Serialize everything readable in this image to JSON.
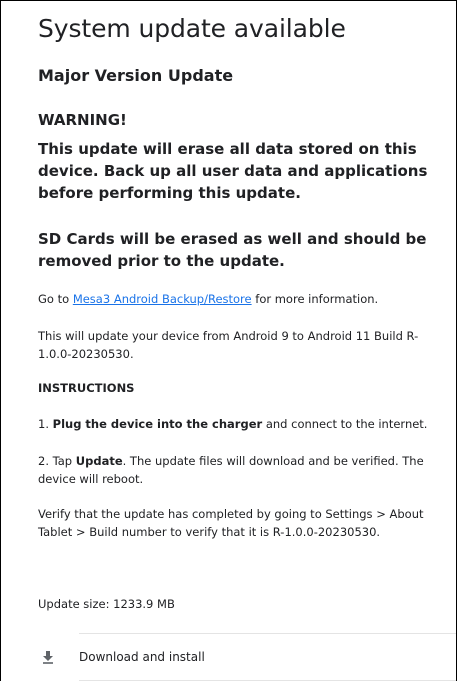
{
  "header": {
    "title": "System update available",
    "subtitle": "Major Version Update"
  },
  "warning": {
    "label": "WARNING!",
    "text": "This update will erase all data stored on this device. Back up all user data and applications before performing this update.",
    "sd_text": "SD Cards will be erased as well and should be removed prior to the update."
  },
  "info": {
    "go_to_prefix": "Go to ",
    "link_text": "Mesa3 Android Backup/Restore",
    "go_to_suffix": " for more information.",
    "android_update": "This will update your device from Android 9 to Android 11 Build R-1.0.0-20230530."
  },
  "instructions": {
    "label": "INSTRUCTIONS",
    "step1_prefix": "1. ",
    "step1_bold": "Plug the device into the charger",
    "step1_suffix": " and connect to the internet.",
    "step2_prefix": "2. Tap ",
    "step2_bold": "Update",
    "step2_suffix": ". The update files will download and be verified. The device will reboot.",
    "verify": "Verify that the update has completed by going to Settings > About Tablet > Build number to verify that it is R-1.0.0-20230530."
  },
  "update_size": "Update size: 1233.9 MB",
  "action": {
    "label": "Download and install",
    "icon": "download-icon"
  },
  "colors": {
    "link": "#1a73e8",
    "text": "#202124",
    "divider": "#e4e4e4"
  }
}
